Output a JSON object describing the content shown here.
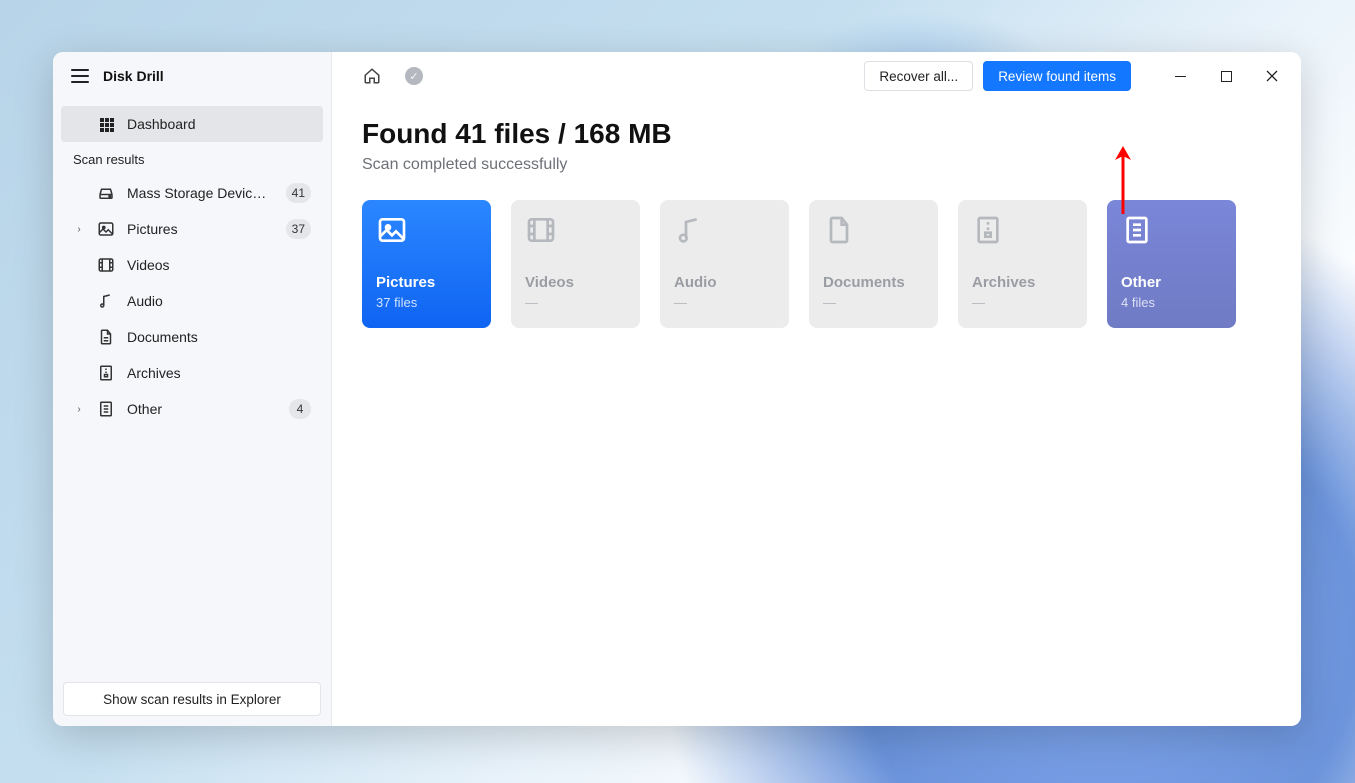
{
  "app": {
    "title": "Disk Drill"
  },
  "sidebar": {
    "dashboard": "Dashboard",
    "section_label": "Scan results",
    "items": [
      {
        "label": "Mass Storage Device USB...",
        "badge": "41",
        "icon": "drive-icon",
        "chev": false
      },
      {
        "label": "Pictures",
        "badge": "37",
        "icon": "picture-icon",
        "chev": true
      },
      {
        "label": "Videos",
        "badge": "",
        "icon": "film-icon",
        "chev": false
      },
      {
        "label": "Audio",
        "badge": "",
        "icon": "music-icon",
        "chev": false
      },
      {
        "label": "Documents",
        "badge": "",
        "icon": "document-icon",
        "chev": false
      },
      {
        "label": "Archives",
        "badge": "",
        "icon": "archive-icon",
        "chev": false
      },
      {
        "label": "Other",
        "badge": "4",
        "icon": "other-icon",
        "chev": true
      }
    ],
    "footer_button": "Show scan results in Explorer"
  },
  "topbar": {
    "recover_all": "Recover all...",
    "review_items": "Review found items"
  },
  "main": {
    "headline": "Found 41 files / 168 MB",
    "subhead": "Scan completed successfully",
    "cards": [
      {
        "title": "Pictures",
        "subtitle": "37 files",
        "state": "blue"
      },
      {
        "title": "Videos",
        "subtitle": "—",
        "state": "muted"
      },
      {
        "title": "Audio",
        "subtitle": "—",
        "state": "muted"
      },
      {
        "title": "Documents",
        "subtitle": "—",
        "state": "muted"
      },
      {
        "title": "Archives",
        "subtitle": "—",
        "state": "muted"
      },
      {
        "title": "Other",
        "subtitle": "4 files",
        "state": "purple"
      }
    ]
  }
}
